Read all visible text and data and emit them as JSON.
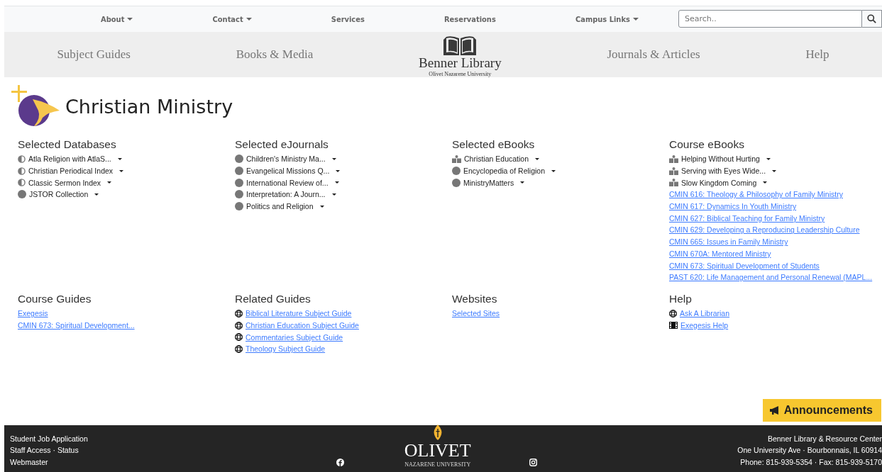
{
  "top_nav": [
    {
      "label": "About",
      "dropdown": true
    },
    {
      "label": "Contact",
      "dropdown": true
    },
    {
      "label": "Services",
      "dropdown": false
    },
    {
      "label": "Reservations",
      "dropdown": false
    },
    {
      "label": "Campus Links",
      "dropdown": true
    }
  ],
  "search": {
    "placeholder": "Search.."
  },
  "main_nav": {
    "left": [
      "Subject Guides",
      "Books & Media"
    ],
    "logo": {
      "name": "Benner Library",
      "subtitle": "Olivet Nazarene University"
    },
    "right": [
      "Journals & Articles",
      "Help"
    ]
  },
  "page_title": "Christian Ministry",
  "sections": [
    {
      "heading": "Selected Databases",
      "items": [
        {
          "kind": "partial",
          "label": "Atla Religion with AtlaS..."
        },
        {
          "kind": "partial",
          "label": "Christian Periodical Index"
        },
        {
          "kind": "partial",
          "label": "Classic Sermon Index"
        },
        {
          "kind": "full",
          "label": "JSTOR Collection"
        }
      ]
    },
    {
      "heading": "Selected eJournals",
      "items": [
        {
          "kind": "full",
          "label": "Children's Ministry Ma..."
        },
        {
          "kind": "full",
          "label": "Evangelical Missions Q..."
        },
        {
          "kind": "full",
          "label": "International Review of..."
        },
        {
          "kind": "full",
          "label": "Interpretation: A Journ..."
        },
        {
          "kind": "full",
          "label": "Politics and Religion"
        }
      ]
    },
    {
      "heading": "Selected eBooks",
      "items": [
        {
          "kind": "ebook",
          "label": "Christian Education"
        },
        {
          "kind": "full",
          "label": "Encyclopedia of Religion"
        },
        {
          "kind": "full",
          "label": "MinistryMatters"
        }
      ]
    },
    {
      "heading": "Course eBooks",
      "items": [
        {
          "kind": "ebook",
          "label": "Helping Without Hurting"
        },
        {
          "kind": "ebook",
          "label": "Serving with Eyes Wide..."
        },
        {
          "kind": "ebook",
          "label": "Slow Kingdom Coming"
        },
        {
          "kind": "link",
          "label": "CMIN 616: Theology & Philosophy of Family Ministry"
        },
        {
          "kind": "link",
          "label": "CMIN 617: Dynamics In Youth Ministry"
        },
        {
          "kind": "link",
          "label": "CMIN 627: Biblical Teaching for Family Ministry"
        },
        {
          "kind": "link",
          "label": "CMIN 629: Developing a Reproducing Leadership Culture"
        },
        {
          "kind": "link",
          "label": "CMIN 665: Issues in Family Ministry"
        },
        {
          "kind": "link",
          "label": "CMIN 670A: Mentored Ministry"
        },
        {
          "kind": "link",
          "label": "CMIN 673: Spiritual Development of Students"
        },
        {
          "kind": "link",
          "label": "PAST 620: Life Management and Personal Renewal (MAPL..."
        }
      ]
    },
    {
      "heading": "Course Guides",
      "items": [
        {
          "kind": "link",
          "label": "Exegesis"
        },
        {
          "kind": "link",
          "label": "CMIN 673: Spiritual Development..."
        }
      ]
    },
    {
      "heading": "Related Guides",
      "items": [
        {
          "kind": "web",
          "label": "Biblical Literature Subject Guide"
        },
        {
          "kind": "web",
          "label": "Christian Education Subject Guide"
        },
        {
          "kind": "web",
          "label": "Commentaries Subject Guide"
        },
        {
          "kind": "web",
          "label": "Theology Subject Guide"
        }
      ]
    },
    {
      "heading": "Websites",
      "items": [
        {
          "kind": "link",
          "label": "Selected Sites"
        }
      ]
    },
    {
      "heading": "Help",
      "items": [
        {
          "kind": "web",
          "label": "Ask A Librarian"
        },
        {
          "kind": "video",
          "label": "Exegesis Help"
        }
      ]
    }
  ],
  "announcements": "Announcements",
  "footer": {
    "left": [
      "Student Job Application",
      "Staff Access · Status",
      "Webmaster"
    ],
    "logo": {
      "name": "OLIVET",
      "subtitle": "NAZARENE UNIVERSITY"
    },
    "right": [
      "Benner Library & Resource Center",
      "One University Ave · Bourbonnais, IL 60914",
      "Phone: 815-939-5354 · Fax: 815-939-5170"
    ]
  }
}
